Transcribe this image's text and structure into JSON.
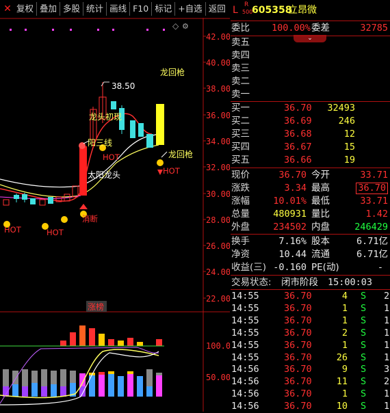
{
  "toolbar": {
    "close": "✕",
    "buttons": [
      "复权",
      "叠加",
      "多股",
      "统计",
      "画线",
      "F10",
      "标记",
      "+自选",
      "返回"
    ]
  },
  "chart": {
    "y_ticks": [
      "42.00",
      "40.00",
      "38.00",
      "36.00",
      "34.00",
      "32.00",
      "30.00",
      "28.00",
      "26.00",
      "24.00",
      "22.00"
    ],
    "sub_ticks": [
      "100.0",
      "50.00"
    ],
    "high_label": "38.50",
    "annotations": {
      "longhuiqiang_top": "龙回枪",
      "longtou": "龙头初现",
      "yangsanxian": "阳三线",
      "hot_mid": "HOT",
      "longhuiqiang_right": "龙回枪",
      "hot_right": "HOT",
      "taiyang": "太阳龙头",
      "hot_left": "HOT",
      "hot_left2": "HOT",
      "xiaoduan": "消断",
      "zhangting": "涨榜"
    }
  },
  "quote": {
    "market": "L",
    "badge_top": "R",
    "badge_bottom": "500",
    "code": "605358",
    "name": "立昂微",
    "weibi_label": "委比",
    "weibi_value": "100.00%",
    "weicha_label": "委差",
    "weicha_value": "32785",
    "sell": [
      {
        "label": "卖五"
      },
      {
        "label": "卖四"
      },
      {
        "label": "卖三"
      },
      {
        "label": "卖二"
      },
      {
        "label": "卖一"
      }
    ],
    "buy": [
      {
        "label": "买一",
        "price": "36.70",
        "vol": "32493"
      },
      {
        "label": "买二",
        "price": "36.69",
        "vol": "246"
      },
      {
        "label": "买三",
        "price": "36.68",
        "vol": "12"
      },
      {
        "label": "买四",
        "price": "36.67",
        "vol": "15"
      },
      {
        "label": "买五",
        "price": "36.66",
        "vol": "19"
      }
    ],
    "stats": [
      {
        "l1": "现价",
        "v1": "36.70",
        "l2": "今开",
        "v2": "33.71"
      },
      {
        "l1": "涨跌",
        "v1": "3.34",
        "l2": "最高",
        "v2": "36.70"
      },
      {
        "l1": "涨幅",
        "v1": "10.01%",
        "l2": "最低",
        "v2": "33.71"
      },
      {
        "l1": "总量",
        "v1": "480931",
        "l2": "量比",
        "v2": "1.42"
      },
      {
        "l1": "外盘",
        "v1": "234502",
        "l2": "内盘",
        "v2": "246429"
      }
    ],
    "stats2": [
      {
        "l1": "换手",
        "v1": "7.16%",
        "l2": "股本",
        "v2": "6.71亿"
      },
      {
        "l1": "净资",
        "v1": "10.44",
        "l2": "流通",
        "v2": "6.71亿"
      },
      {
        "l1": "收益(三)",
        "v1": "-0.160",
        "l2": "PE(动)",
        "v2": "-"
      }
    ],
    "status_label": "交易状态:",
    "status_value": "闭市阶段",
    "status_time": "15:00:03"
  },
  "ticks": [
    {
      "t": "14:55",
      "p": "36.70",
      "v": "4",
      "s": "S",
      "n": "2"
    },
    {
      "t": "14:55",
      "p": "36.70",
      "v": "1",
      "s": "S",
      "n": "1"
    },
    {
      "t": "14:55",
      "p": "36.70",
      "v": "1",
      "s": "S",
      "n": "1"
    },
    {
      "t": "14:55",
      "p": "36.70",
      "v": "2",
      "s": "S",
      "n": "1"
    },
    {
      "t": "14:55",
      "p": "36.70",
      "v": "1",
      "s": "S",
      "n": "1"
    },
    {
      "t": "14:55",
      "p": "36.70",
      "v": "26",
      "s": "S",
      "n": "1"
    },
    {
      "t": "14:56",
      "p": "36.70",
      "v": "9",
      "s": "S",
      "n": "3"
    },
    {
      "t": "14:56",
      "p": "36.70",
      "v": "11",
      "s": "S",
      "n": "2"
    },
    {
      "t": "14:56",
      "p": "36.70",
      "v": "1",
      "s": "S",
      "n": "1"
    },
    {
      "t": "14:56",
      "p": "36.70",
      "v": "10",
      "s": "S",
      "n": "1"
    }
  ],
  "colors": {
    "up": "#ff3030",
    "down": "#40e0e0",
    "accent": "#ffff40",
    "grid": "#b01010"
  }
}
